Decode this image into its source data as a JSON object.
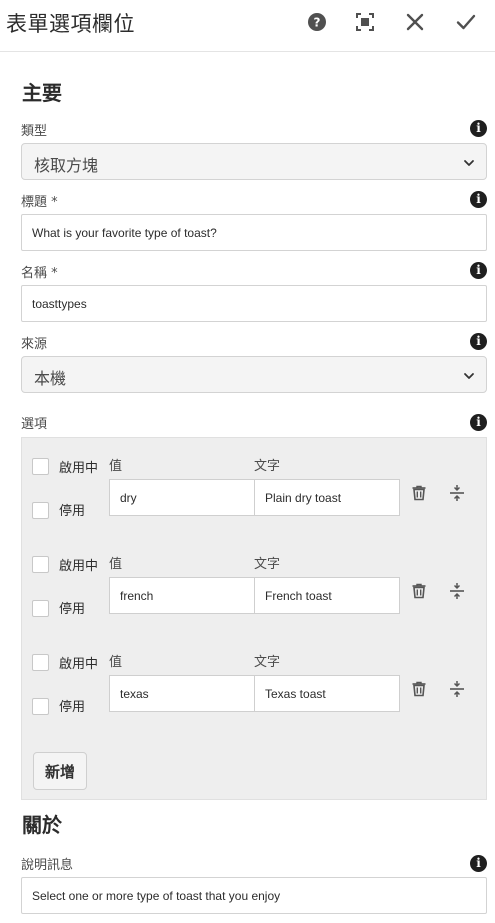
{
  "header": {
    "title": "表單選項欄位",
    "actions": [
      "help-icon",
      "fullscreen-icon",
      "close-icon",
      "done-checkmark-icon"
    ]
  },
  "main_section": {
    "title": "主要",
    "type_field": {
      "label": "類型",
      "value": "核取方塊"
    },
    "title_field": {
      "label": "標題 *",
      "value": "What is your favorite type of toast?"
    },
    "name_field": {
      "label": "名稱 *",
      "value": "toasttypes"
    },
    "source_field": {
      "label": "來源",
      "value": "本機"
    },
    "options": {
      "label": "選項",
      "enabled_label": "啟用中",
      "disabled_label": "停用",
      "value_column": "值",
      "text_column": "文字",
      "rows": [
        {
          "value": "dry",
          "text": "Plain dry toast"
        },
        {
          "value": "french",
          "text": "French toast"
        },
        {
          "value": "texas",
          "text": "Texas toast"
        }
      ],
      "add_label": "新增"
    }
  },
  "about_section": {
    "title": "關於",
    "description_field": {
      "label": "說明訊息",
      "value": "Select one or more type of toast that you enjoy"
    }
  },
  "colors": {
    "panel_background": "#eeeeee",
    "icon": "#2c2c2c"
  }
}
